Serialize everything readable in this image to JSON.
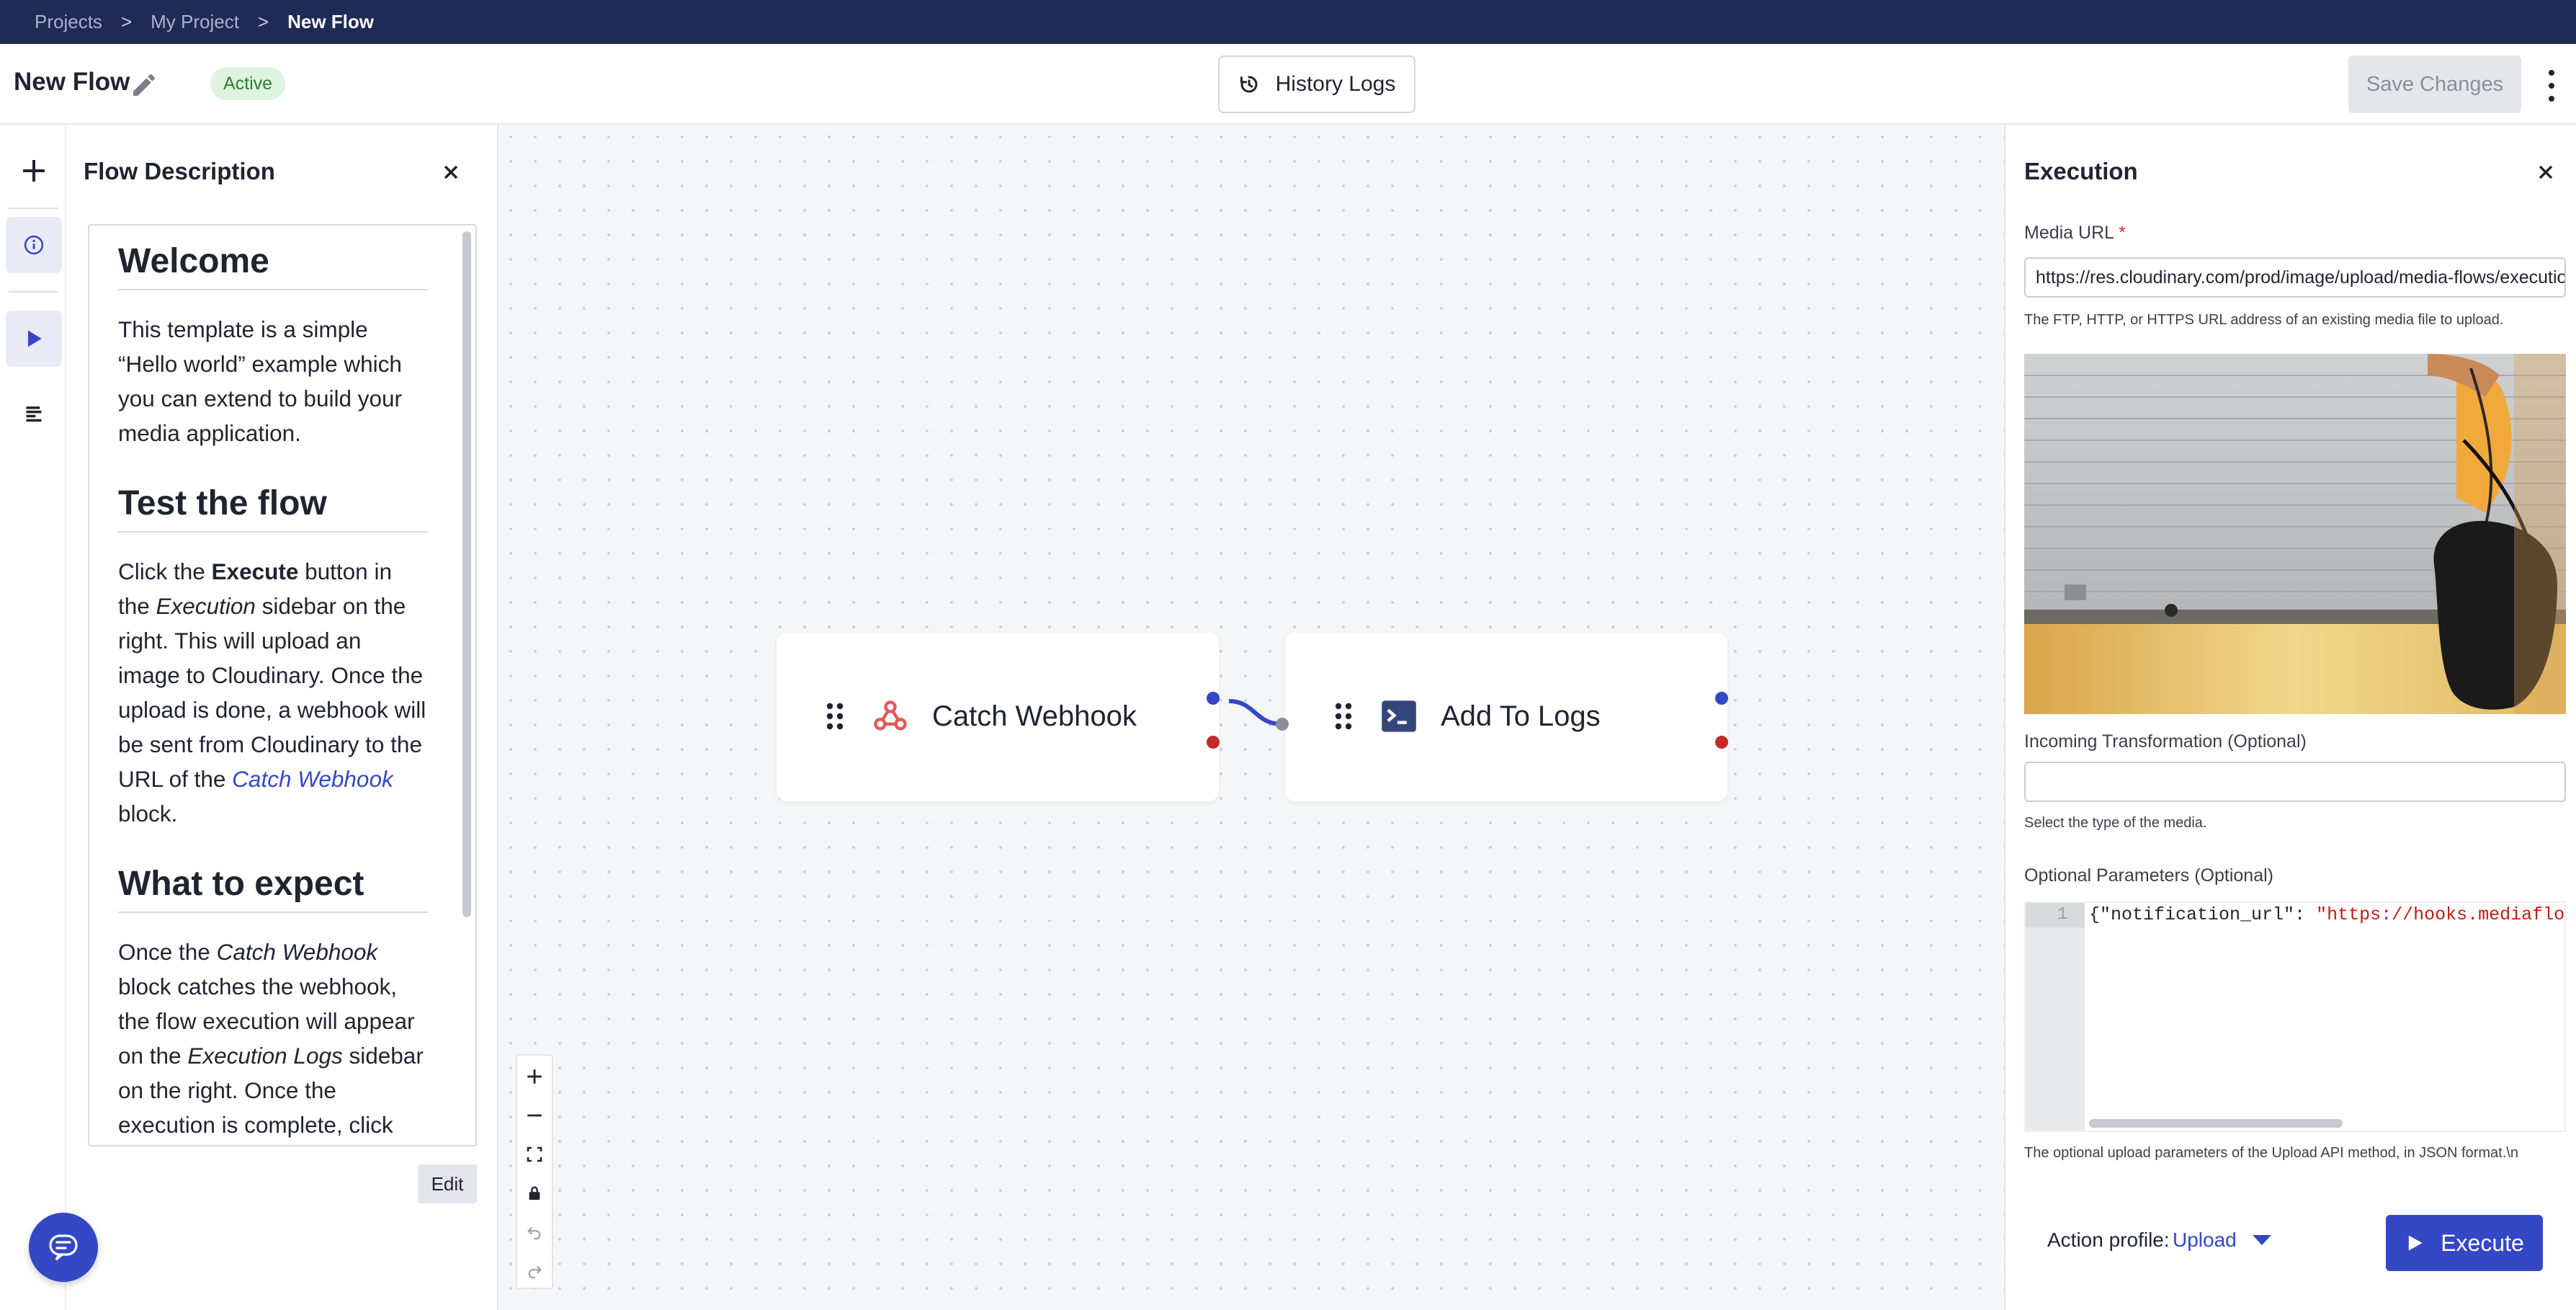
{
  "breadcrumb": {
    "items": [
      "Projects",
      "My Project",
      "New Flow"
    ],
    "separator": ">"
  },
  "header": {
    "title": "New Flow",
    "status": "Active",
    "history_label": "History Logs",
    "save_label": "Save Changes"
  },
  "description_panel": {
    "title": "Flow Description",
    "edit_label": "Edit",
    "sections": [
      {
        "heading": "Welcome",
        "p1": "This template is a simple “Hello world” example which you can extend to build your media application."
      },
      {
        "heading": "Test the flow",
        "t1": "Click the ",
        "b1": "Execute",
        "t2": " button in the ",
        "i1": "Execution",
        "t3": " sidebar on the right. This will upload an image to Cloudinary. Once the upload is done, a webhook will be sent from Cloudinary to the URL of the ",
        "link": "Catch Webhook",
        "t4": " block."
      },
      {
        "heading": "What to expect",
        "t1": "Once the ",
        "i1": "Catch Webhook",
        "t2": " block catches the webhook, the flow execution will appear on the ",
        "i2": "Execution Logs",
        "t3": " sidebar on the right. Once the execution is complete, click"
      }
    ]
  },
  "canvas": {
    "nodes": [
      {
        "label": "Catch Webhook",
        "icon": "webhook-icon"
      },
      {
        "label": "Add To Logs",
        "icon": "terminal-icon"
      }
    ]
  },
  "execution_panel": {
    "title": "Execution",
    "media_url": {
      "label": "Media URL",
      "required_mark": "*",
      "value": "https://res.cloudinary.com/prod/image/upload/media-flows/execution",
      "help": "The FTP, HTTP, or HTTPS URL address of an existing media file to upload."
    },
    "incoming_transformation": {
      "label": "Incoming Transformation (Optional)",
      "value": "",
      "help": "Select the type of the media."
    },
    "optional_parameters": {
      "label": "Optional Parameters (Optional)",
      "line_number": "1",
      "code_key": "{\"notification_url\": ",
      "code_value": "\"https://hooks.mediaflows",
      "help": "The optional upload parameters of the Upload API method, in JSON format.\\n"
    },
    "action_profile_label": "Action profile:",
    "action_profile_value": "Upload",
    "execute_label": "Execute"
  },
  "colors": {
    "topbar": "#1f2a55",
    "accent": "#3448c5",
    "status_bg": "#dff3e0",
    "status_text": "#2e7d32",
    "port_out": "#3448c5",
    "port_err": "#c62828"
  }
}
